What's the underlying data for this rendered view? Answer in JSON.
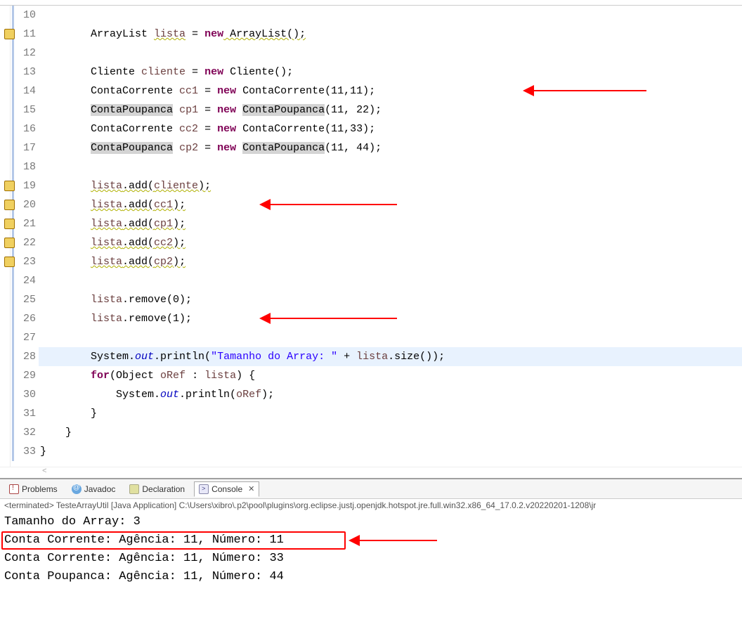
{
  "gutter": [
    {
      "n": "10",
      "warn": false
    },
    {
      "n": "11",
      "warn": true
    },
    {
      "n": "12",
      "warn": false
    },
    {
      "n": "13",
      "warn": false
    },
    {
      "n": "14",
      "warn": false
    },
    {
      "n": "15",
      "warn": false
    },
    {
      "n": "16",
      "warn": false
    },
    {
      "n": "17",
      "warn": false
    },
    {
      "n": "18",
      "warn": false
    },
    {
      "n": "19",
      "warn": true
    },
    {
      "n": "20",
      "warn": true
    },
    {
      "n": "21",
      "warn": true
    },
    {
      "n": "22",
      "warn": true
    },
    {
      "n": "23",
      "warn": true
    },
    {
      "n": "24",
      "warn": false
    },
    {
      "n": "25",
      "warn": false
    },
    {
      "n": "26",
      "warn": false
    },
    {
      "n": "27",
      "warn": false
    },
    {
      "n": "28",
      "warn": false
    },
    {
      "n": "29",
      "warn": false
    },
    {
      "n": "30",
      "warn": false
    },
    {
      "n": "31",
      "warn": false
    },
    {
      "n": "32",
      "warn": false
    },
    {
      "n": "33",
      "warn": false
    }
  ],
  "code": {
    "l10": "",
    "l11_a": "        ArrayList ",
    "l11_b": "lista",
    "l11_c": " = ",
    "l11_d": "new",
    "l11_e": " ArrayList();",
    "l12": "",
    "l13_a": "        Cliente ",
    "l13_b": "cliente",
    "l13_c": " = ",
    "l13_d": "new",
    "l13_e": " Cliente();",
    "l14_a": "        ContaCorrente ",
    "l14_b": "cc1",
    "l14_c": " = ",
    "l14_d": "new",
    "l14_e": " ContaCorrente(11,11);",
    "l15_a": "        ",
    "l15_b": "ContaPoupanca",
    "l15_c": " ",
    "l15_d": "cp1",
    "l15_e": " = ",
    "l15_f": "new",
    "l15_g": " ",
    "l15_h": "ContaPoupanca",
    "l15_i": "(11, 22);",
    "l16_a": "        ContaCorrente ",
    "l16_b": "cc2",
    "l16_c": " = ",
    "l16_d": "new",
    "l16_e": " ContaCorrente(11,33);",
    "l17_a": "        ",
    "l17_b": "ContaPoupanca",
    "l17_c": " ",
    "l17_d": "cp2",
    "l17_e": " = ",
    "l17_f": "new",
    "l17_g": " ",
    "l17_h": "ContaPoupanca",
    "l17_i": "(11, 44);",
    "l18": "",
    "l19_a": "        ",
    "l19_b": "lista",
    "l19_c": ".add(",
    "l19_d": "cliente",
    "l19_e": ");",
    "l20_a": "        ",
    "l20_b": "lista",
    "l20_c": ".add(",
    "l20_d": "cc1",
    "l20_e": ");",
    "l21_a": "        ",
    "l21_b": "lista",
    "l21_c": ".add(",
    "l21_d": "cp1",
    "l21_e": ");",
    "l22_a": "        ",
    "l22_b": "lista",
    "l22_c": ".add(",
    "l22_d": "cc2",
    "l22_e": ");",
    "l23_a": "        ",
    "l23_b": "lista",
    "l23_c": ".add(",
    "l23_d": "cp2",
    "l23_e": ");",
    "l24": "",
    "l25_a": "        ",
    "l25_b": "lista",
    "l25_c": ".remove(0);",
    "l26_a": "        ",
    "l26_b": "lista",
    "l26_c": ".remove(1);",
    "l27": "",
    "l28_a": "        System.",
    "l28_b": "out",
    "l28_c": ".println(",
    "l28_d": "\"Tamanho do Array: \"",
    "l28_e": " + ",
    "l28_f": "lista",
    "l28_g": ".size());",
    "l29_a": "        ",
    "l29_b": "for",
    "l29_c": "(Object ",
    "l29_d": "oRef",
    "l29_e": " : ",
    "l29_f": "lista",
    "l29_g": ") {",
    "l30_a": "            System.",
    "l30_b": "out",
    "l30_c": ".println(",
    "l30_d": "oRef",
    "l30_e": ");",
    "l31": "        }",
    "l32": "    }",
    "l33": "}"
  },
  "panels": {
    "problems": "Problems",
    "javadoc": "Javadoc",
    "declaration": "Declaration",
    "console": "Console"
  },
  "terminated": "<terminated> TesteArrayUtil [Java Application] C:\\Users\\xibro\\.p2\\pool\\plugins\\org.eclipse.justj.openjdk.hotspot.jre.full.win32.x86_64_17.0.2.v20220201-1208\\jr",
  "console": {
    "l1": "Tamanho do Array: 3",
    "l2": "Conta Corrente: Agência: 11, Número: 11",
    "l3": "Conta Corrente: Agência: 11, Número: 33",
    "l4": "Conta Poupanca: Agência: 11, Número: 44"
  }
}
